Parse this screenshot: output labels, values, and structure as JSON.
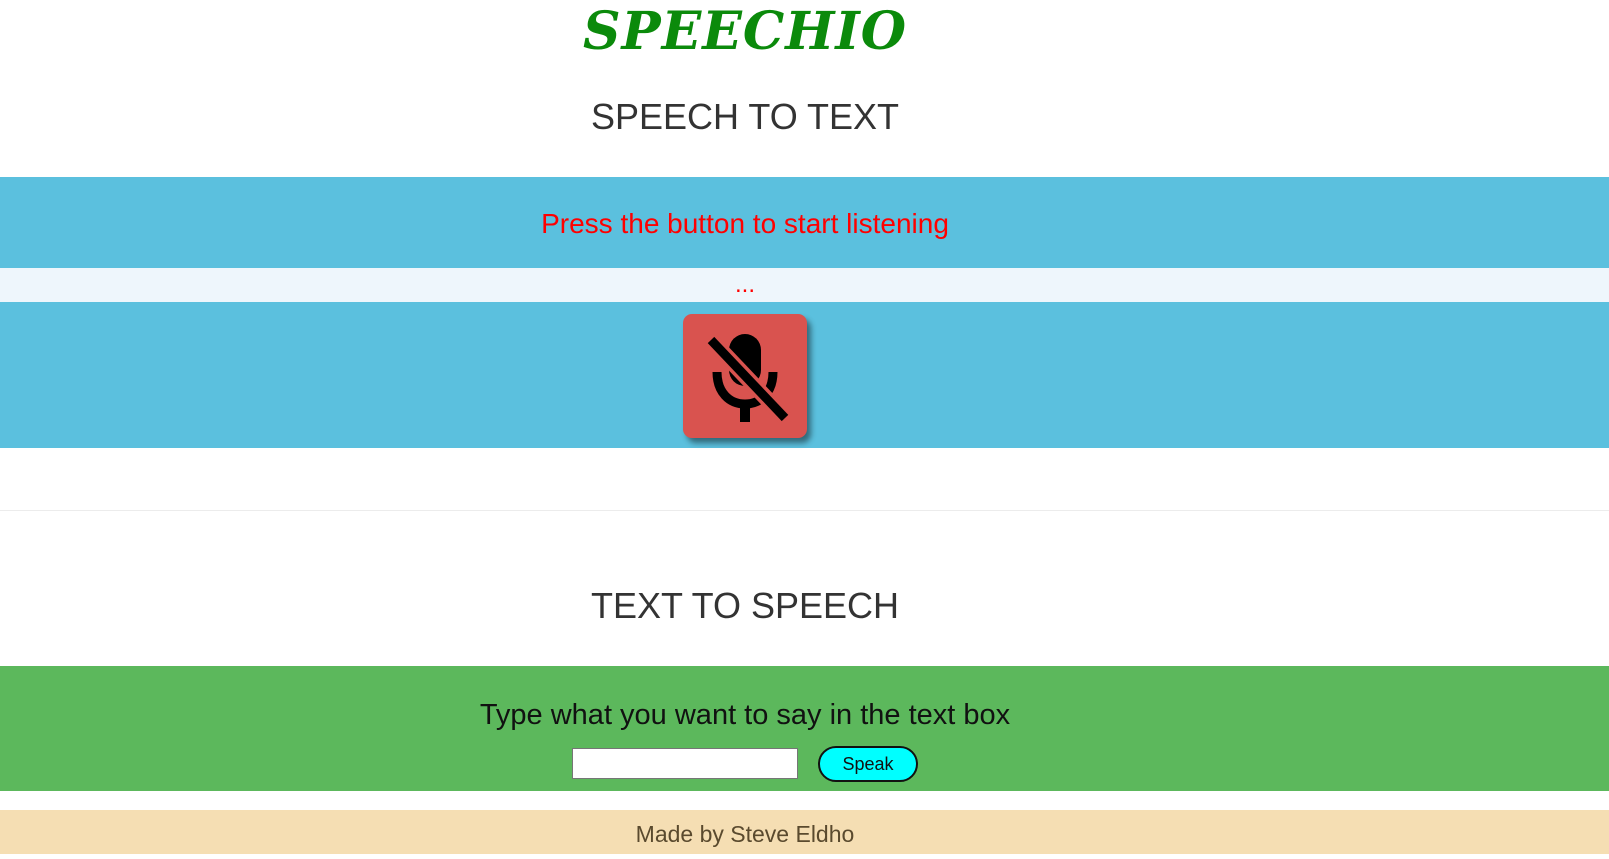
{
  "logo": {
    "text": "SPEECHIO",
    "color": "#0b8a0b"
  },
  "speech_to_text": {
    "heading": "SPEECH TO TEXT",
    "prompt": "Press the button to start listening",
    "result": "...",
    "mic_button": {
      "icon": "mic-off-icon",
      "state": "muted"
    }
  },
  "text_to_speech": {
    "heading": "TEXT TO SPEECH",
    "prompt": "Type what you want to say in the text box",
    "input": {
      "value": "",
      "placeholder": ""
    },
    "speak_label": "Speak"
  },
  "footer": {
    "text": "Made by Steve Eldho"
  },
  "colors": {
    "stt_band": "#5bc0de",
    "result_band": "#eef6fc",
    "mic_button": "#d9534f",
    "tts_band": "#5cb85c",
    "speak_button": "#00ffff",
    "footer": "#f5deb3",
    "prompt_text": "#ff0000"
  }
}
